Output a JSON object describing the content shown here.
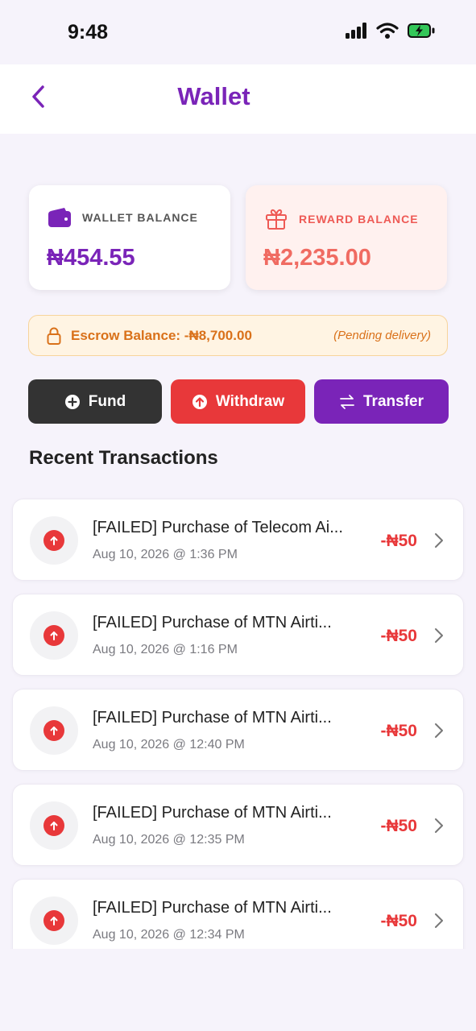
{
  "status": {
    "time": "9:48",
    "icons": [
      "signal-icon",
      "wifi-icon",
      "battery-charging-icon"
    ]
  },
  "header": {
    "title": "Wallet",
    "back_icon": "chevron-left-icon"
  },
  "wallet": {
    "label": "WALLET BALANCE",
    "amount": "₦454.55",
    "icon": "wallet-icon"
  },
  "reward": {
    "label": "REWARD BALANCE",
    "amount": "₦2,235.00",
    "icon": "gift-icon"
  },
  "escrow": {
    "text": "Escrow Balance: -₦8,700.00",
    "note": "(Pending delivery)",
    "icon": "lock-icon"
  },
  "actions": {
    "fund": "Fund",
    "withdraw": "Withdraw",
    "transfer": "Transfer"
  },
  "section_title": "Recent Transactions",
  "transactions": [
    {
      "title": "[FAILED] Purchase of Telecom Ai...",
      "date": "Aug 10, 2026 @ 1:36 PM",
      "amount": "-₦50"
    },
    {
      "title": "[FAILED] Purchase of MTN Airti...",
      "date": "Aug 10, 2026 @ 1:16 PM",
      "amount": "-₦50"
    },
    {
      "title": "[FAILED] Purchase of MTN Airti...",
      "date": "Aug 10, 2026 @ 12:40 PM",
      "amount": "-₦50"
    },
    {
      "title": "[FAILED] Purchase of MTN Airti...",
      "date": "Aug 10, 2026 @ 12:35 PM",
      "amount": "-₦50"
    },
    {
      "title": "[FAILED] Purchase of MTN Airti...",
      "date": "Aug 10, 2026 @ 12:34 PM",
      "amount": "-₦50"
    }
  ],
  "colors": {
    "brand": "#7a24b8",
    "danger": "#e8383a",
    "reward": "#f06b62",
    "escrow": "#d9711a",
    "dark": "#333333"
  }
}
